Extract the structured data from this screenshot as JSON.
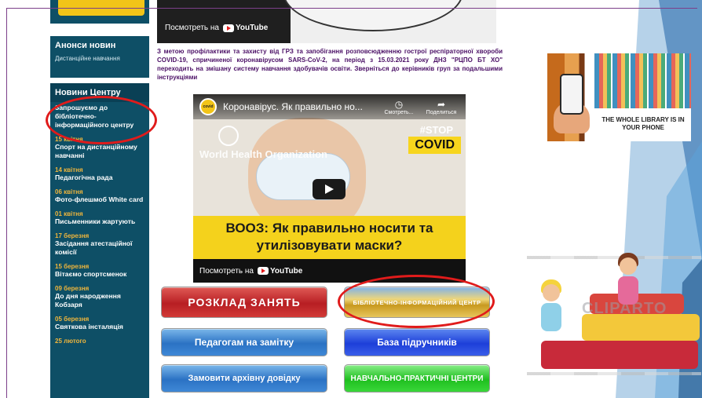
{
  "colors": {
    "sidebar_bg": "#0e4f66",
    "news_date": "#f0b63c",
    "notice_text": "#4b1066",
    "highlight_ellipse": "#e01b1b",
    "slide_deco": "#2f7fc1"
  },
  "top_video": {
    "watch_label": "Посмотреть на",
    "youtube_label": "YouTube"
  },
  "sidebar": {
    "announcements": {
      "title": "Анонси новин",
      "subtitle": "Дистанційне навчання"
    },
    "news": {
      "title": "Новини Центру",
      "items": [
        {
          "date": "",
          "title": "Запрошуємо до бібліотечно-інформаційного центру"
        },
        {
          "date": "15 квітня",
          "title": "Спорт на дистанційному навчанні"
        },
        {
          "date": "14 квітня",
          "title": "Педагогічна рада"
        },
        {
          "date": "06 квітня",
          "title": "Фото-флешмоб White card"
        },
        {
          "date": "01 квітня",
          "title": "Письменники жартують"
        },
        {
          "date": "17 березня",
          "title": "Засідання атестаційної комісії"
        },
        {
          "date": "15 березня",
          "title": "Вітаємо спортсменок"
        },
        {
          "date": "09 березня",
          "title": "До дня народження Кобзаря"
        },
        {
          "date": "05 березня",
          "title": "Святкова інсталяція"
        },
        {
          "date": "25 лютого",
          "title": ""
        }
      ]
    }
  },
  "notice": "З метою профілактики та захисту від ГРЗ та запобігання розповсюдженню гострої респіраторної хвороби COVID-19, спричиненої коронавірусом SARS-CoV-2, на період з 15.03.2021 року ДНЗ \"РЦПО БТ ХО\" переходить на змішану систему навчання здобувачів освіти. Зверніться до керівників груп за подальшими інструкціями",
  "video": {
    "channel_badge": "covid",
    "title": "Коронавірус. Як правильно но...",
    "watch_later": "Смотреть...",
    "share": "Поделиться",
    "who_text": "World Health Organization",
    "stop_tag": "#STOP",
    "covid_tag": "COVID",
    "banner": "ВООЗ: Як правильно носити та утилізовувати маски?",
    "watch_label": "Посмотреть на",
    "youtube_label": "YouTube"
  },
  "buttons": {
    "schedule": "РОЗКЛАД ЗАНЯТЬ",
    "library": "БІБЛІОТЕЧНО-ІНФОРМАЦІЙНИЙ ЦЕНТР",
    "teachers": "Педагогам на замітку",
    "textbooks": "База підручників",
    "archive": "Замовити архівну довідку",
    "training": "НАВЧАЛЬНО-ПРАКТИЧНІ ЦЕНТРИ"
  },
  "ads": {
    "library_text": "THE WHOLE LIBRARY IS IN YOUR PHONE",
    "watermark": "CLIPARTO"
  }
}
